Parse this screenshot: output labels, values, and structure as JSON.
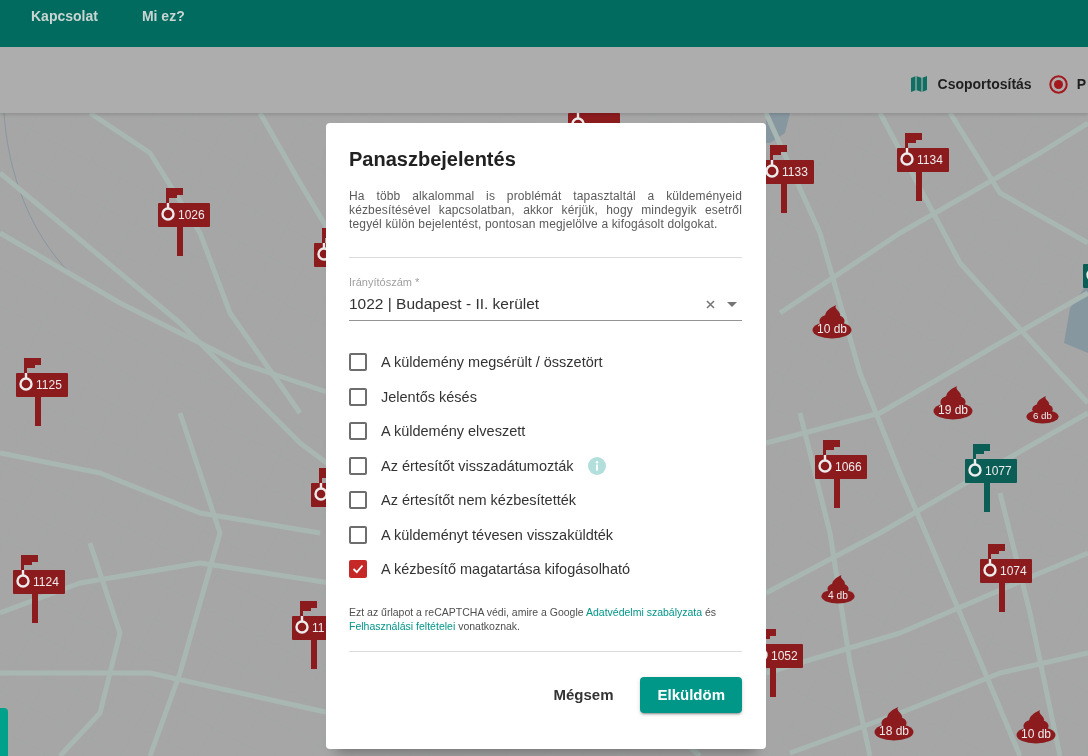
{
  "navbar": {
    "links": [
      "Kapcsolat",
      "Mi ez?"
    ]
  },
  "toolbar": {
    "grouping_button": {
      "label": "Csoportosítás"
    },
    "radio_options": [
      {
        "label": "P",
        "selected": true
      }
    ]
  },
  "map": {
    "markers": [
      {
        "kind": "mailbox",
        "color": "#8c1b1e"
      },
      {
        "kind": "mailbox",
        "number": "1134",
        "color": "#8c1b1e"
      },
      {
        "kind": "mailbox",
        "number": "1133",
        "color": "#8c1b1e"
      },
      {
        "kind": "mailbox",
        "number": "1026",
        "color": "#8c1b1e"
      },
      {
        "kind": "mailbox",
        "color": "#8c1b1e"
      },
      {
        "kind": "mailbox",
        "color": "#0b5e55"
      },
      {
        "kind": "cluster",
        "count": "10 db"
      },
      {
        "kind": "cluster",
        "count": "19 db"
      },
      {
        "kind": "cluster",
        "count": "6 db"
      },
      {
        "kind": "mailbox",
        "number": "1125",
        "color": "#8c1b1e"
      },
      {
        "kind": "mailbox",
        "number": "1066",
        "color": "#8c1b1e"
      },
      {
        "kind": "mailbox",
        "number": "1077",
        "color": "#0b5e55"
      },
      {
        "kind": "mailbox",
        "color": "#8c1b1e"
      },
      {
        "kind": "mailbox",
        "number": "1074",
        "color": "#8c1b1e"
      },
      {
        "kind": "cluster",
        "count": "4 db"
      },
      {
        "kind": "mailbox",
        "number": "1124",
        "color": "#8c1b1e"
      },
      {
        "kind": "mailbox",
        "number": "11",
        "color": "#8c1b1e"
      },
      {
        "kind": "mailbox",
        "number": "1052",
        "color": "#8c1b1e"
      },
      {
        "kind": "cluster",
        "count": "18 db"
      },
      {
        "kind": "cluster",
        "count": "10 db"
      }
    ]
  },
  "dialog": {
    "title": "Panaszbejelentés",
    "description": "Ha több alkalommal is problémát tapasztaltál a küldeményeid kézbesítésével kapcsolatban, akkor kérjük, hogy mindegyik esetről tegyél külön bejelentést, pontosan megjelölve a kifogásolt dolgokat.",
    "postcode_field": {
      "label": "Irányítószám *",
      "value": "1022 | Budapest - II. kerület"
    },
    "options": [
      {
        "label": "A küldemény megsérült / összetört",
        "checked": false,
        "info": false
      },
      {
        "label": "Jelentős késés",
        "checked": false,
        "info": false
      },
      {
        "label": "A küldemény elveszett",
        "checked": false,
        "info": false
      },
      {
        "label": "Az értesítőt visszadátumozták",
        "checked": false,
        "info": true
      },
      {
        "label": "Az értesítőt nem kézbesítették",
        "checked": false,
        "info": false
      },
      {
        "label": "A küldeményt tévesen visszaküldték",
        "checked": false,
        "info": false
      },
      {
        "label": "A kézbesítő magatartása kifogásolható",
        "checked": true,
        "info": false
      }
    ],
    "recaptcha_notice": [
      {
        "kind": "text",
        "text": "Ezt az űrlapot a reCAPTCHA védi, amire a Google"
      },
      {
        "kind": "link",
        "text": "Adatvédelmi szabályzata"
      },
      {
        "kind": "text",
        "text": "és"
      },
      {
        "kind": "link",
        "text": "Felhasználási feltételei"
      },
      {
        "kind": "text",
        "text": "vonatkoznak."
      }
    ],
    "buttons": [
      {
        "label": "Mégsem",
        "kind": "text"
      },
      {
        "label": "Elküldöm",
        "kind": "primary"
      }
    ]
  }
}
